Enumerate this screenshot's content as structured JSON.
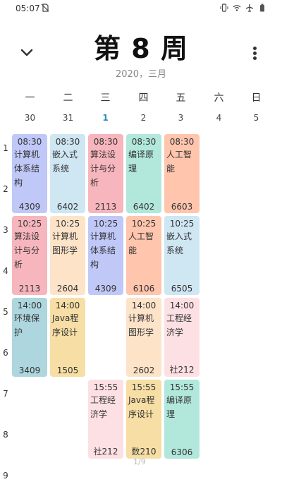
{
  "status_bar": {
    "time": "05:07",
    "icons": [
      "sim-off-icon",
      "vibrate-icon",
      "wifi-icon",
      "airplane-icon",
      "battery-icon"
    ]
  },
  "header": {
    "title": "第 8 周",
    "subtitle": "2020，三月"
  },
  "weekdays": [
    "一",
    "二",
    "三",
    "四",
    "五",
    "六",
    "日"
  ],
  "dates": [
    "30",
    "31",
    "1",
    "2",
    "3",
    "4",
    "5"
  ],
  "today_index": 2,
  "periods": [
    "1",
    "2",
    "3",
    "4",
    "5",
    "6",
    "7",
    "8",
    "9"
  ],
  "page_hint": "1/9",
  "colors": {
    "blue": "#bfc8f7",
    "lightblue": "#cfe6f3",
    "pink": "#f7b6bd",
    "mint": "#b2e8dc",
    "salmon": "#ffc5ad",
    "peach": "#fde3c8",
    "teal": "#add6de",
    "yellow": "#f6dea5",
    "lightpink": "#fde0e3",
    "today": "#2b8cbf"
  },
  "courses": [
    {
      "day": 0,
      "start": 1,
      "span": 2,
      "time": "08:30",
      "name": "计算机体系结构",
      "room": "4309",
      "color": "blue"
    },
    {
      "day": 1,
      "start": 1,
      "span": 2,
      "time": "08:30",
      "name": "嵌入式系统",
      "room": "6402",
      "color": "lightblue"
    },
    {
      "day": 2,
      "start": 1,
      "span": 2,
      "time": "08:30",
      "name": "算法设计与分析",
      "room": "2113",
      "color": "pink"
    },
    {
      "day": 3,
      "start": 1,
      "span": 2,
      "time": "08:30",
      "name": "编译原理",
      "room": "6402",
      "color": "mint"
    },
    {
      "day": 4,
      "start": 1,
      "span": 2,
      "time": "08:30",
      "name": "人工智能",
      "room": "6603",
      "color": "salmon"
    },
    {
      "day": 0,
      "start": 3,
      "span": 2,
      "time": "10:25",
      "name": "算法设计与分析",
      "room": "2113",
      "color": "pink"
    },
    {
      "day": 1,
      "start": 3,
      "span": 2,
      "time": "10:25",
      "name": "计算机图形学",
      "room": "2604",
      "color": "peach"
    },
    {
      "day": 2,
      "start": 3,
      "span": 2,
      "time": "10:25",
      "name": "计算机体系结构",
      "room": "4309",
      "color": "blue"
    },
    {
      "day": 3,
      "start": 3,
      "span": 2,
      "time": "10:25",
      "name": "人工智能",
      "room": "6106",
      "color": "salmon"
    },
    {
      "day": 4,
      "start": 3,
      "span": 2,
      "time": "10:25",
      "name": "嵌入式系统",
      "room": "6505",
      "color": "lightblue"
    },
    {
      "day": 0,
      "start": 5,
      "span": 2,
      "time": "14:00",
      "name": "环境保护",
      "room": "3409",
      "color": "teal"
    },
    {
      "day": 1,
      "start": 5,
      "span": 2,
      "time": "14:00",
      "name": "Java程序设计",
      "room": "1505",
      "color": "yellow"
    },
    {
      "day": 3,
      "start": 5,
      "span": 2,
      "time": "14:00",
      "name": "计算机图形学",
      "room": "2602",
      "color": "peach"
    },
    {
      "day": 4,
      "start": 5,
      "span": 2,
      "time": "14:00",
      "name": "工程经济学",
      "room": "社212",
      "color": "lightpink"
    },
    {
      "day": 2,
      "start": 7,
      "span": 2,
      "time": "15:55",
      "name": "工程经济学",
      "room": "社212",
      "color": "lightpink"
    },
    {
      "day": 3,
      "start": 7,
      "span": 2,
      "time": "15:55",
      "name": "Java程序设计",
      "room": "数210",
      "color": "yellow"
    },
    {
      "day": 4,
      "start": 7,
      "span": 2,
      "time": "15:55",
      "name": "编译原理",
      "room": "6306",
      "color": "mint"
    }
  ]
}
